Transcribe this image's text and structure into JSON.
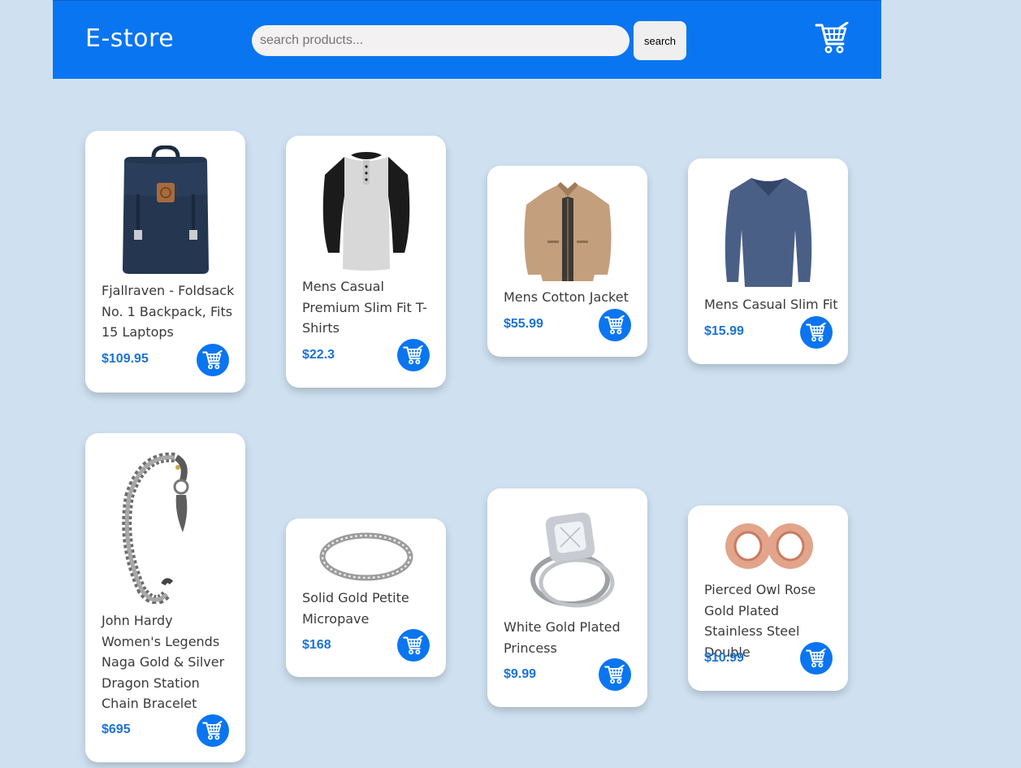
{
  "header": {
    "brand": "E-store",
    "search_placeholder": "search products...",
    "search_value": "",
    "search_button": "search",
    "cart_icon": "shopping-cart-icon"
  },
  "colors": {
    "header_bg": "#0a75f0",
    "page_bg": "#cfe1f1",
    "price": "#1a73d6",
    "cart_button": "#0a75f0"
  },
  "products": [
    {
      "title": "Fjallraven - Foldsack No. 1 Backpack, Fits 15 Laptops",
      "price": "$109.95",
      "image": "backpack"
    },
    {
      "title": "Mens Casual Premium Slim Fit T-Shirts",
      "price": "$22.3",
      "image": "raglan-tshirt"
    },
    {
      "title": "Mens Cotton Jacket",
      "price": "$55.99",
      "image": "jacket"
    },
    {
      "title": "Mens Casual Slim Fit",
      "price": "$15.99",
      "image": "long-sleeve-shirt"
    },
    {
      "title": "John Hardy Women's Legends Naga Gold & Silver Dragon Station Chain Bracelet",
      "price": "$695",
      "image": "dragon-bracelet"
    },
    {
      "title": "Solid Gold Petite Micropave",
      "price": "$168",
      "image": "ring"
    },
    {
      "title": "White Gold Plated Princess",
      "price": "$9.99",
      "image": "engagement-ring"
    },
    {
      "title": "Pierced Owl Rose Gold Plated Stainless Steel Double",
      "price": "$10.99",
      "image": "ear-tunnels"
    }
  ]
}
